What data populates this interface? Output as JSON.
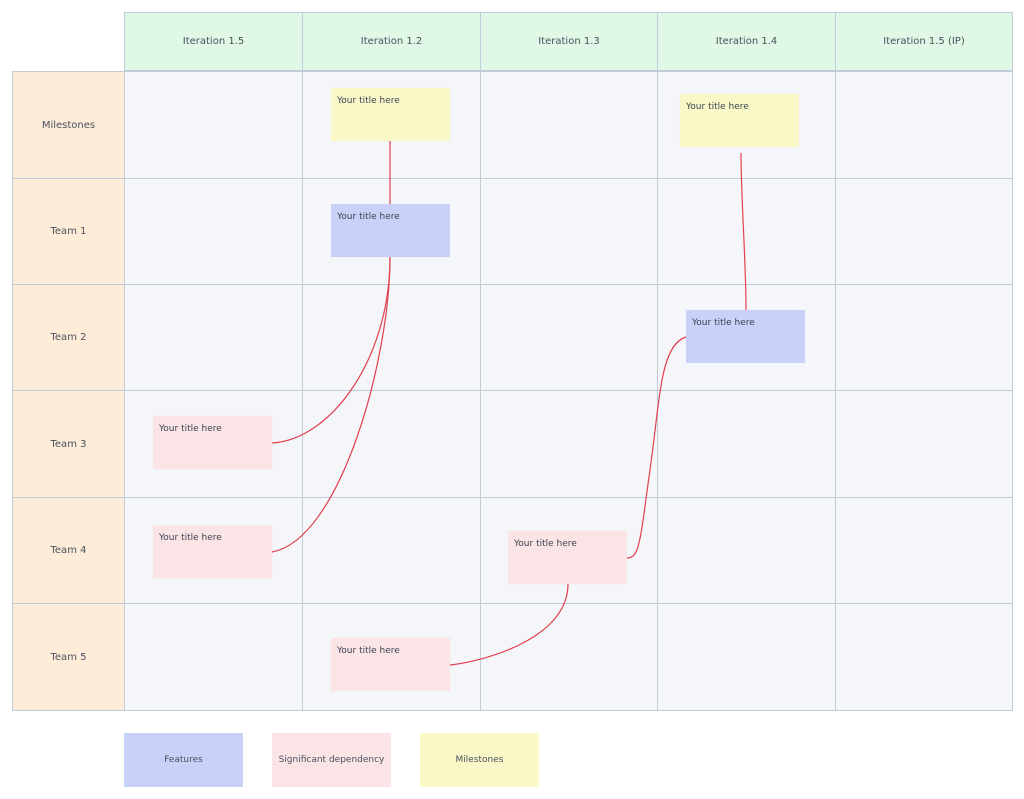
{
  "columns": [
    "Iteration 1.5",
    "Iteration 1.2",
    "Iteration 1.3",
    "Iteration 1.4",
    "Iteration 1.5 (IP)"
  ],
  "rows": [
    "Milestones",
    "Team 1",
    "Team 2",
    "Team 3",
    "Team 4",
    "Team 5"
  ],
  "cards": [
    {
      "id": "c1",
      "title": "Your title here",
      "type": "milestone",
      "row": 0,
      "col": 1
    },
    {
      "id": "c2",
      "title": "Your title here",
      "type": "milestone",
      "row": 0,
      "col": 3
    },
    {
      "id": "c3",
      "title": "Your title here",
      "type": "feature",
      "row": 1,
      "col": 1
    },
    {
      "id": "c4",
      "title": "Your title here",
      "type": "feature",
      "row": 2,
      "col": 3
    },
    {
      "id": "c5",
      "title": "Your title here",
      "type": "dependency",
      "row": 3,
      "col": 0
    },
    {
      "id": "c6",
      "title": "Your title here",
      "type": "dependency",
      "row": 4,
      "col": 0
    },
    {
      "id": "c7",
      "title": "Your title here",
      "type": "dependency",
      "row": 4,
      "col": 2
    },
    {
      "id": "c8",
      "title": "Your title here",
      "type": "dependency",
      "row": 5,
      "col": 1
    }
  ],
  "connections": [
    {
      "from": "c1",
      "to": "c3"
    },
    {
      "from": "c3",
      "to": "c5"
    },
    {
      "from": "c3",
      "to": "c6"
    },
    {
      "from": "c2",
      "to": "c4"
    },
    {
      "from": "c4",
      "to": "c7"
    },
    {
      "from": "c7",
      "to": "c8"
    }
  ],
  "legend": [
    {
      "label": "Features",
      "type": "feature"
    },
    {
      "label": "Significant dependency",
      "type": "dependency"
    },
    {
      "label": "Milestones",
      "type": "milestone"
    }
  ],
  "colors": {
    "header_bg": "#e0f8e6",
    "row_label_bg": "#fdecd8",
    "grid_bg": "#f5f6f9",
    "feature": "#c8d2f8",
    "dependency": "#fbe4e5",
    "milestone": "#fbf8c8",
    "connector": "#e0404f"
  }
}
